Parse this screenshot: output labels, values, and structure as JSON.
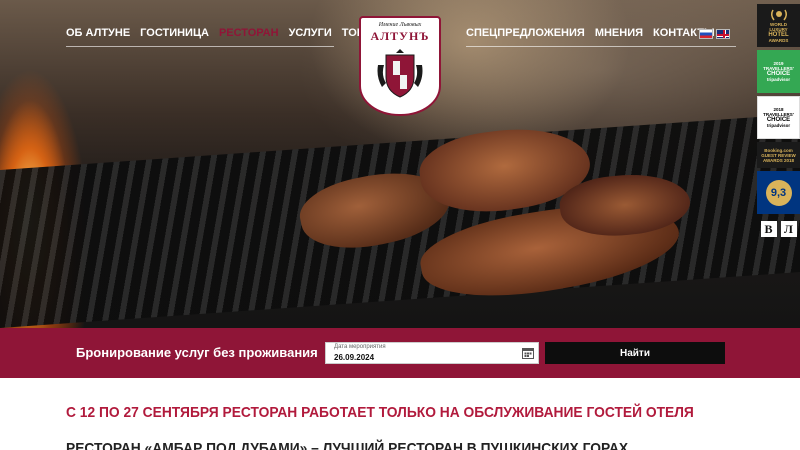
{
  "nav": {
    "left": [
      {
        "label": "ОБ АЛТУНЕ",
        "active": false
      },
      {
        "label": "ГОСТИНИЦА",
        "active": false
      },
      {
        "label": "РЕСТОРАН",
        "active": true
      },
      {
        "label": "УСЛУГИ",
        "active": false
      },
      {
        "label": "ТОРЖЕСТВА",
        "active": false
      }
    ],
    "right": [
      {
        "label": "СПЕЦПРЕДЛОЖЕНИЯ",
        "active": false
      },
      {
        "label": "МНЕНИЯ",
        "active": false
      },
      {
        "label": "КОНТАКТЫ",
        "active": false
      }
    ],
    "active_color": "#8f1537"
  },
  "logo": {
    "subtitle": "Имение Львовых",
    "name": "АЛТУНЪ"
  },
  "languages": [
    {
      "code": "ru",
      "icon": "russia-flag-icon"
    },
    {
      "code": "en",
      "icon": "uk-flag-icon"
    }
  ],
  "awards": {
    "hotel": {
      "line1": "WORLD",
      "line2": "LUXURY",
      "line3": "HOTEL",
      "line4": "AWARDS"
    },
    "tc1": {
      "line1": "2019",
      "line2": "TRAVELLERS'",
      "line3": "CHOICE",
      "line4": "tripadvisor"
    },
    "tc2": {
      "line1": "2018",
      "line2": "TRAVELLERS'",
      "line3": "CHOICE",
      "line4": "tripadvisor"
    },
    "booking": {
      "line1": "Booking.com",
      "line2": "GUEST REVIEW",
      "line3": "AWARDS 2018"
    },
    "score": {
      "value": "9,3"
    }
  },
  "social": [
    {
      "label": "В",
      "icon": "vk-icon"
    },
    {
      "label": "Л",
      "icon": "livejournal-icon"
    }
  ],
  "booking": {
    "label": "Бронирование услуг без проживания",
    "date_caption": "Дата мероприятия",
    "date_value": "26.09.2024",
    "button_label": "Найти",
    "bar_color": "#8f1537"
  },
  "content": {
    "announcement": "С 12 ПО 27 СЕНТЯБРЯ РЕСТОРАН РАБОТАЕТ ТОЛЬКО НА ОБСЛУЖИВАНИЕ ГОСТЕЙ ОТЕЛЯ",
    "subheading": "РЕСТОРАН «АМБАР ПОД ДУБАМИ» – ЛУЧШИЙ РЕСТОРАН В ПУШКИНСКИХ ГОРАХ"
  }
}
